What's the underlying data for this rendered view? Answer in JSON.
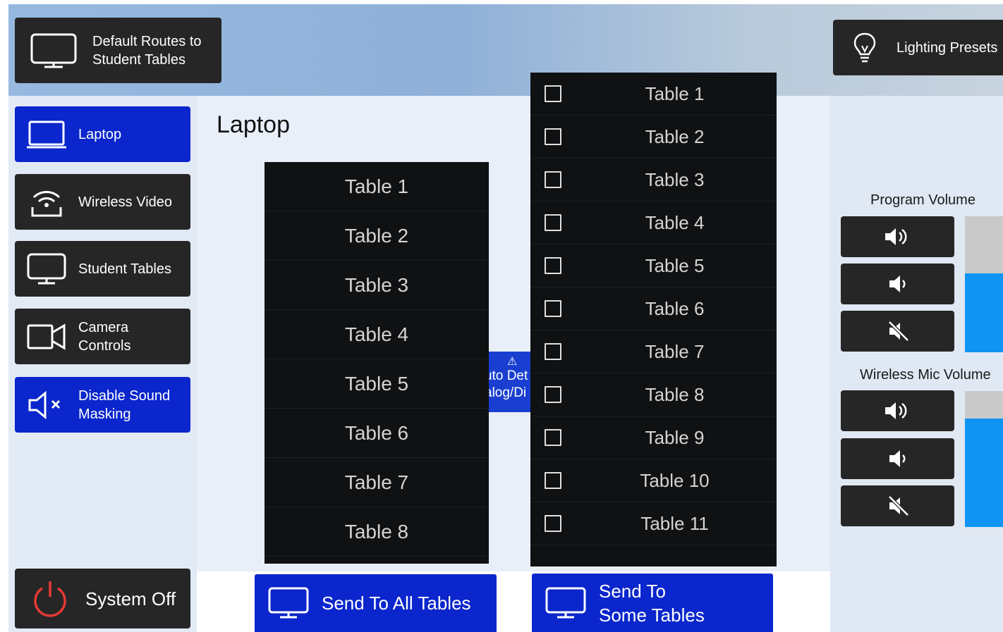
{
  "header": {
    "default_routes_label": "Default Routes to Student Tables",
    "lighting_presets_label": "Lighting Presets"
  },
  "sidebar": {
    "items": [
      {
        "label": "Laptop",
        "icon": "laptop-icon",
        "active": true
      },
      {
        "label": "Wireless Video",
        "icon": "wireless-video-icon",
        "active": false
      },
      {
        "label": "Student Tables",
        "icon": "monitor-icon",
        "active": false
      },
      {
        "label": "Camera Controls",
        "icon": "camera-icon",
        "active": false
      },
      {
        "label": "Disable Sound Masking",
        "icon": "speaker-mute-icon",
        "active": true
      }
    ],
    "system_off_label": "System Off"
  },
  "main": {
    "title": "Laptop",
    "table_list": [
      "Table 1",
      "Table 2",
      "Table 3",
      "Table 4",
      "Table 5",
      "Table 6",
      "Table 7",
      "Table 8"
    ],
    "warning": {
      "icon": "warning-icon",
      "line1": "uto Det",
      "line2": "alog/Di"
    },
    "checklist": [
      {
        "label": "Table 1",
        "checked": false
      },
      {
        "label": "Table 2",
        "checked": false
      },
      {
        "label": "Table 3",
        "checked": false
      },
      {
        "label": "Table 4",
        "checked": false
      },
      {
        "label": "Table 5",
        "checked": false
      },
      {
        "label": "Table 6",
        "checked": false
      },
      {
        "label": "Table 7",
        "checked": false
      },
      {
        "label": "Table 8",
        "checked": false
      },
      {
        "label": "Table 9",
        "checked": false
      },
      {
        "label": "Table 10",
        "checked": false
      },
      {
        "label": "Table 11",
        "checked": false
      }
    ],
    "send_all_label": "Send To All Tables",
    "send_some_label": "Send To Some Tables"
  },
  "volume": {
    "program": {
      "title": "Program Volume",
      "level_fraction": 0.58
    },
    "wireless_mic": {
      "title": "Wireless Mic Volume",
      "level_fraction": 0.8
    }
  },
  "colors": {
    "accent_blue": "#0a26cc",
    "volume_fill": "#1094f4",
    "dark_button": "#262626",
    "power_red": "#e53935"
  }
}
